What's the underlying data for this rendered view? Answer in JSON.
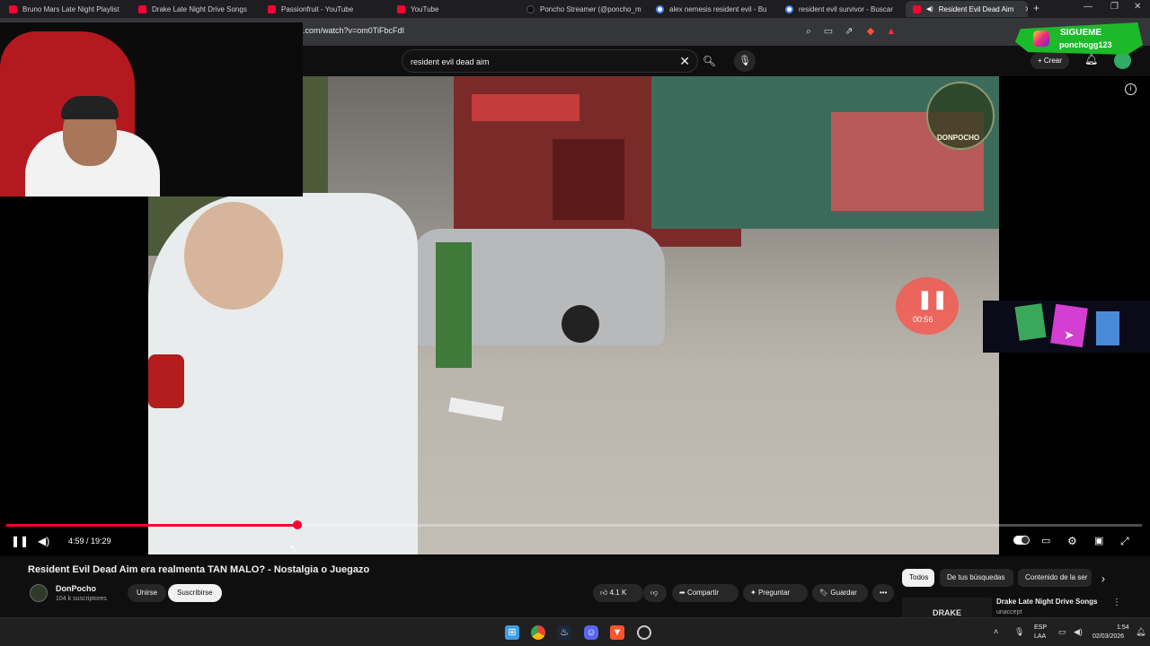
{
  "browser": {
    "tabs": [
      {
        "label": "Bruno Mars Late Night Playlist",
        "icon": "youtube-icon"
      },
      {
        "label": "Drake Late Night Drive Songs",
        "icon": "youtube-icon"
      },
      {
        "label": "Passionfruit - YouTube",
        "icon": "youtube-icon"
      },
      {
        "label": "YouTube",
        "icon": "youtube-icon"
      },
      {
        "label": "Poncho Streamer (@poncho_m",
        "icon": "tiktok-icon"
      },
      {
        "label": "alex nemesis resident evil - Bu",
        "icon": "google-icon"
      },
      {
        "label": "resident evil survivor - Buscar",
        "icon": "google-icon"
      },
      {
        "label": "Resident Evil Dead Aim",
        "icon": "youtube-icon",
        "active": true
      }
    ],
    "url": ".com/watch?v=om0TiFbcFdI"
  },
  "youtube": {
    "search_query": "resident evil  dead aim",
    "create_label": "Crear"
  },
  "overlay": {
    "follow_title": "SIGUEME",
    "follow_handle": "ponchogg123",
    "video_logo_text": "DONPOCHO",
    "video_timer": "00:56"
  },
  "player": {
    "current_time": "4:59",
    "duration": "19:29",
    "time_display": "4:59 / 19:29",
    "progress": 0.256
  },
  "video": {
    "title": "Resident Evil Dead Aim era realmenta TAN MALO? - Nostalgia o Juegazo",
    "channel": "DonPocho",
    "subscribers": "104 k suscriptores",
    "join_label": "Unirse",
    "subscribe_label": "Suscribirse",
    "likes": "4.1 K",
    "share_label": "Compartir",
    "ask_label": "Preguntar",
    "save_label": "Guardar"
  },
  "chips": [
    "Todos",
    "De tus búsquedas",
    "Contenido de la ser"
  ],
  "recommendation": {
    "title": "Drake Late Night Drive Songs",
    "channel": "unaccept",
    "thumb_text": "DRAKE"
  },
  "taskbar": {
    "lang1": "ESP",
    "lang2": "LAA",
    "time": "1:54",
    "date": "02/03/2026"
  },
  "colors": {
    "accent": "#ff0033",
    "follow_badge": "#1db92b"
  }
}
